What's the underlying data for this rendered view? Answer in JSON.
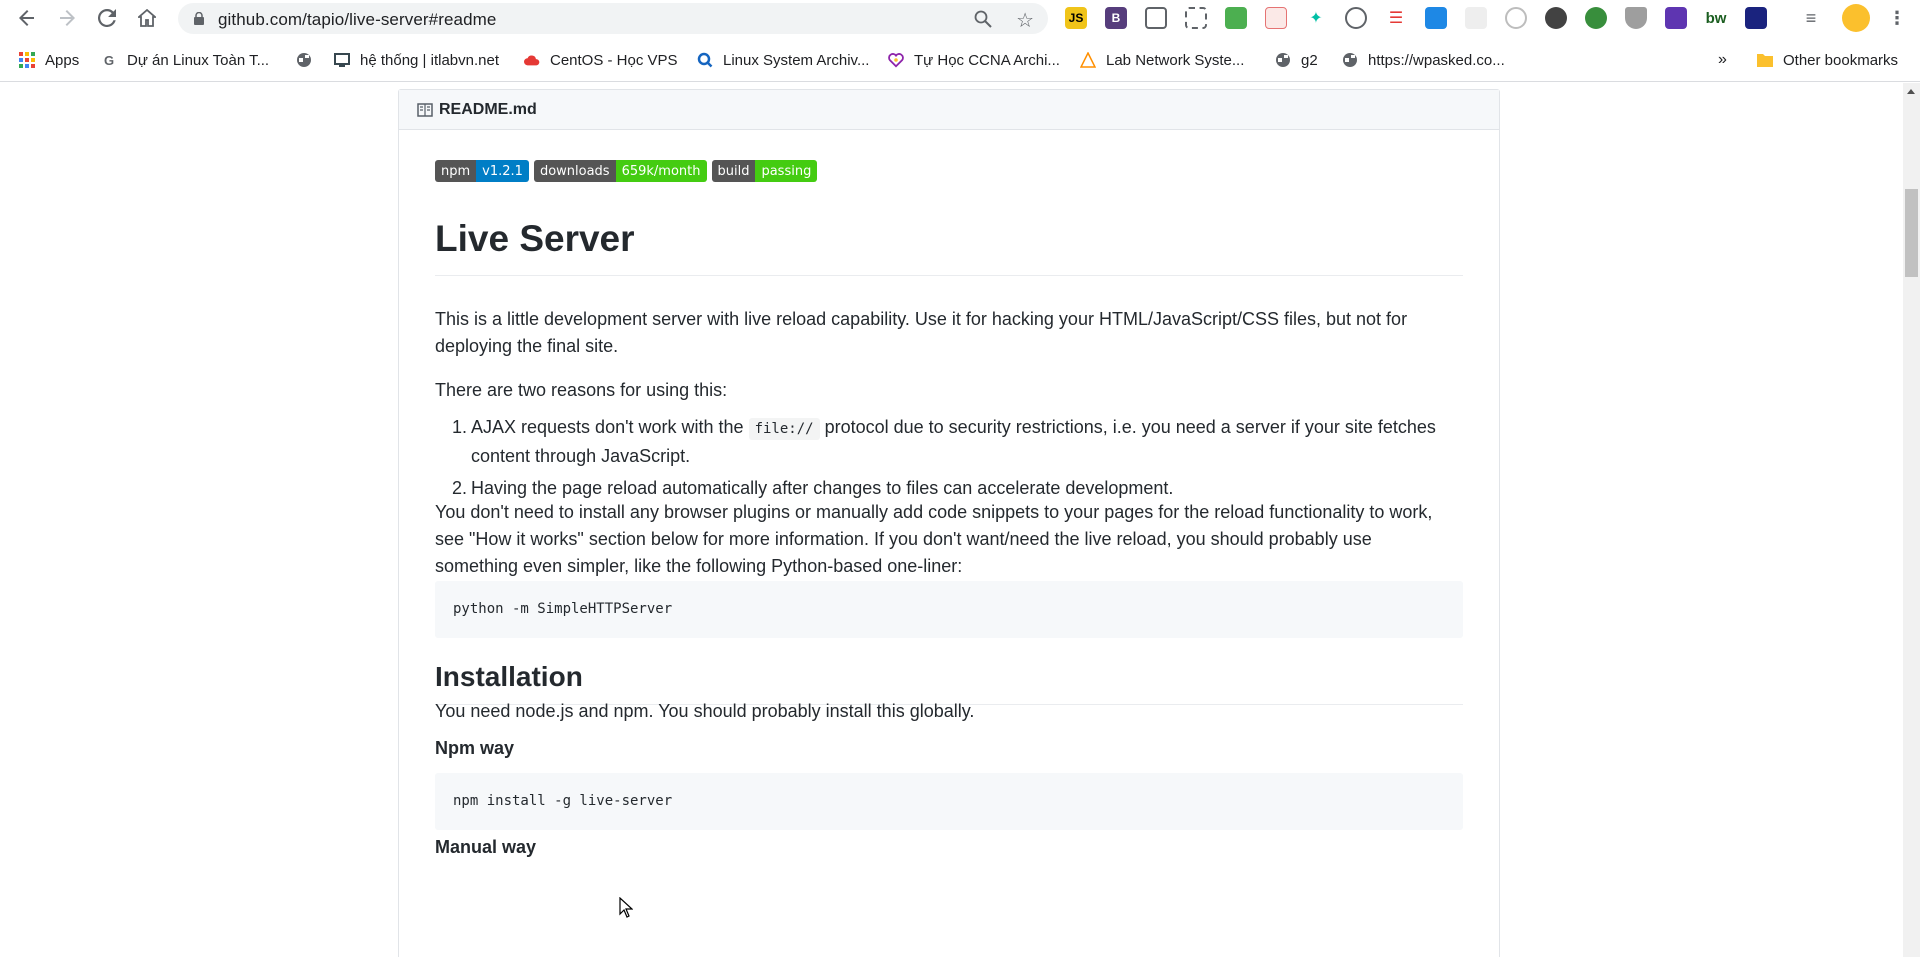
{
  "browser": {
    "url": "github.com/tapio/live-server#readme",
    "extensions": [
      "js-icon",
      "bootstrap-icon",
      "barcode-icon",
      "screenshot-icon",
      "inbox-icon",
      "calendar-icon",
      "hummingbird-icon",
      "grammar-icon",
      "lines-icon",
      "dropbox-icon",
      "blank-icon",
      "eye-icon",
      "moon-icon",
      "globe-icon",
      "shield-icon",
      "box-icon",
      "bw-icon",
      "screen-icon",
      "media-icon",
      "avatar-icon"
    ],
    "ext_bw_label": "bw"
  },
  "bookmarks": {
    "items": [
      {
        "label": "Apps",
        "icon": "apps-grid-icon"
      },
      {
        "label": "Dự án Linux Toàn T...",
        "icon": "g-icon"
      },
      {
        "label": "",
        "icon": "globe-icon"
      },
      {
        "label": "hệ thống | itlabvn.net",
        "icon": "monitor-icon"
      },
      {
        "label": "CentOS - Học VPS",
        "icon": "cloud-icon"
      },
      {
        "label": "Linux System Archiv...",
        "icon": "search-icon"
      },
      {
        "label": "Tự Học CCNA Archi...",
        "icon": "heart-icon"
      },
      {
        "label": "Lab Network Syste...",
        "icon": "triangle-icon"
      },
      {
        "label": "g2",
        "icon": "globe-icon"
      },
      {
        "label": "https://wpasked.co...",
        "icon": "globe-icon"
      }
    ],
    "overflow": "»",
    "other": "Other bookmarks"
  },
  "readme": {
    "filename": "README.md",
    "badges": [
      {
        "left": "npm",
        "right": "v1.2.1",
        "color": "#007ec6"
      },
      {
        "left": "downloads",
        "right": "659k/month",
        "color": "#4c1"
      },
      {
        "left": "build",
        "right": "passing",
        "color": "#4c1"
      }
    ],
    "title": "Live Server",
    "intro_line1": "This is a little development server with live reload capability. Use it for hacking your HTML/JavaScript/CSS files, but not for",
    "intro_line2": "deploying the final site.",
    "reasons_intro": "There are two reasons for using this:",
    "reason1_pre": "AJAX requests don't work with the ",
    "reason1_code": "file://",
    "reason1_post": " protocol due to security restrictions, i.e. you need a server if your site fetches",
    "reason1_line2": "content through JavaScript.",
    "reason2": "Having the page reload automatically after changes to files can accelerate development.",
    "no_plugins_line1": "You don't need to install any browser plugins or manually add code snippets to your pages for the reload functionality to work,",
    "no_plugins_line2": "see \"How it works\" section below for more information. If you don't want/need the live reload, you should probably use",
    "no_plugins_line3": "something even simpler, like the following Python-based one-liner:",
    "python_cmd": "python -m SimpleHTTPServer",
    "installation_heading": "Installation",
    "install_text": "You need node.js and npm. You should probably install this globally.",
    "npm_way": "Npm way",
    "npm_cmd": "npm install -g live-server",
    "manual_way": "Manual way"
  },
  "colors": {
    "accent": "#0366d6",
    "badge_blue": "#007ec6",
    "badge_green": "#4c1"
  }
}
